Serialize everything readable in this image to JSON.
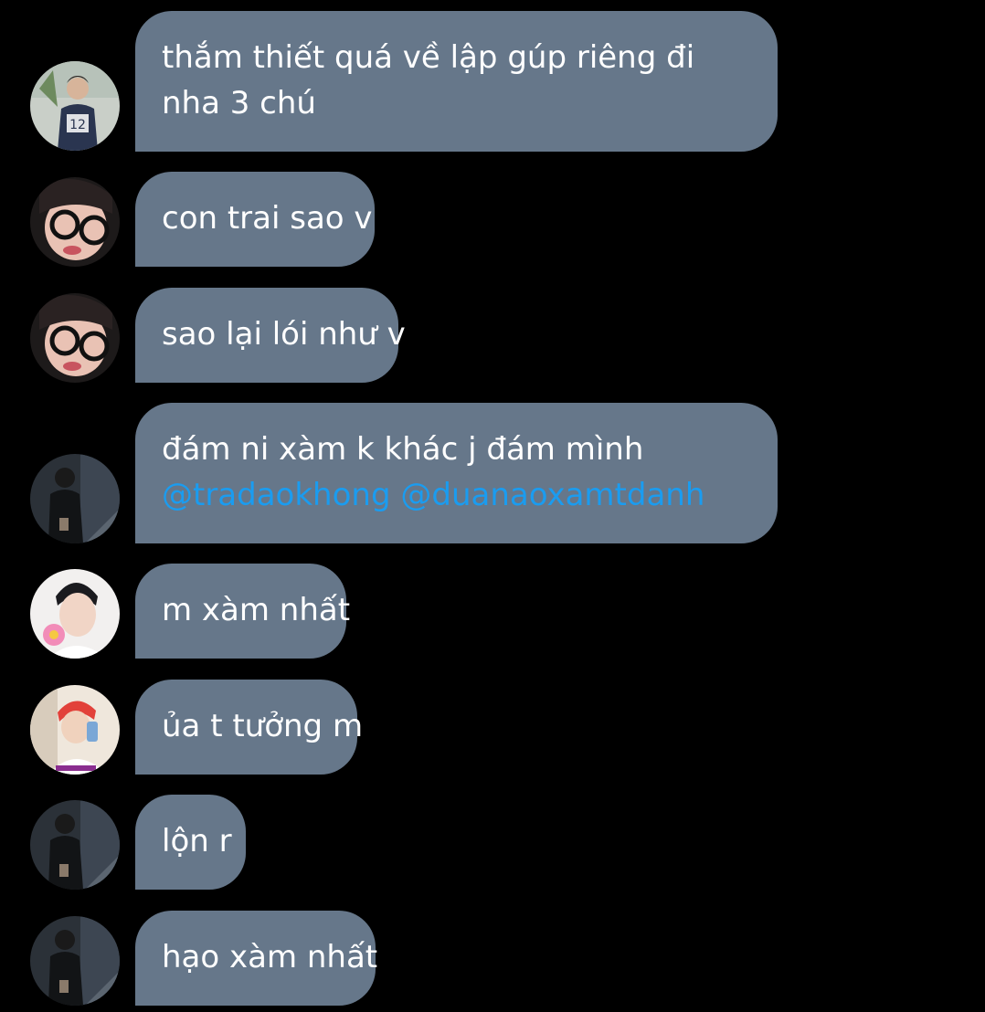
{
  "messages": [
    {
      "text": "thắm thiết quá về lập gúp riêng đi nha 3 chú",
      "avatar": "avatar-boy-jersey"
    },
    {
      "text": "con trai sao v",
      "avatar": "avatar-glasses"
    },
    {
      "text": "sao lại lói như v",
      "avatar": "avatar-glasses"
    },
    {
      "text": "đám ni xàm k khác j đám mình",
      "mentions": [
        "@tradaokhong",
        "@duanaoxamtdanh"
      ],
      "avatar": "avatar-dark-stairs"
    },
    {
      "text": "m xàm nhất",
      "avatar": "avatar-flower"
    },
    {
      "text": "ủa t tưởng m",
      "avatar": "avatar-red-hair"
    },
    {
      "text": "lộn r",
      "avatar": "avatar-dark-stairs"
    },
    {
      "text": "hạo xàm nhất",
      "avatar": "avatar-dark-stairs"
    }
  ],
  "colors": {
    "background": "#000000",
    "bubble": "#66778a",
    "text": "#ffffff",
    "mention": "#1a9cf0"
  }
}
